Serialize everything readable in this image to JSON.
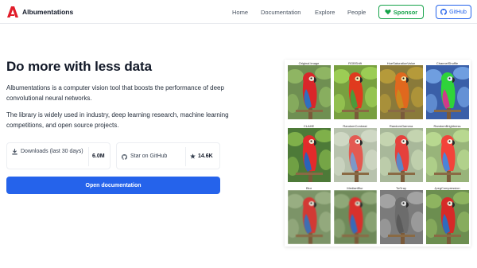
{
  "nav": {
    "brand": "Albumentations",
    "links": [
      "Home",
      "Documentation",
      "Explore",
      "People"
    ],
    "sponsor_label": "Sponsor",
    "github_label": "GitHub"
  },
  "hero": {
    "title": "Do more with less data",
    "paragraph1": "Albumentations is a computer vision tool that boosts the performance of deep convolutional neural networks.",
    "paragraph2": "The library is widely used in industry, deep learning research, machine learning competitions, and open source projects."
  },
  "stats": {
    "downloads_label": "Downloads (last 30 days)",
    "downloads_value": "6.0M",
    "github_label": "Star on GitHub",
    "stars_value": "14.6K"
  },
  "cta": {
    "label": "Open documentation"
  },
  "augmentations": [
    "Original image",
    "RGBShift",
    "HueSaturationValue",
    "ChannelShuffle",
    "CLAHE",
    "RandomContrast",
    "RandomGamma",
    "RandomBrightness",
    "Blur",
    "MedianBlur",
    "ToGray",
    "JpegCompression"
  ],
  "colors": {
    "primary": "#2563eb",
    "sponsor": "#16a34a",
    "brand_red": "#e11d2a"
  }
}
